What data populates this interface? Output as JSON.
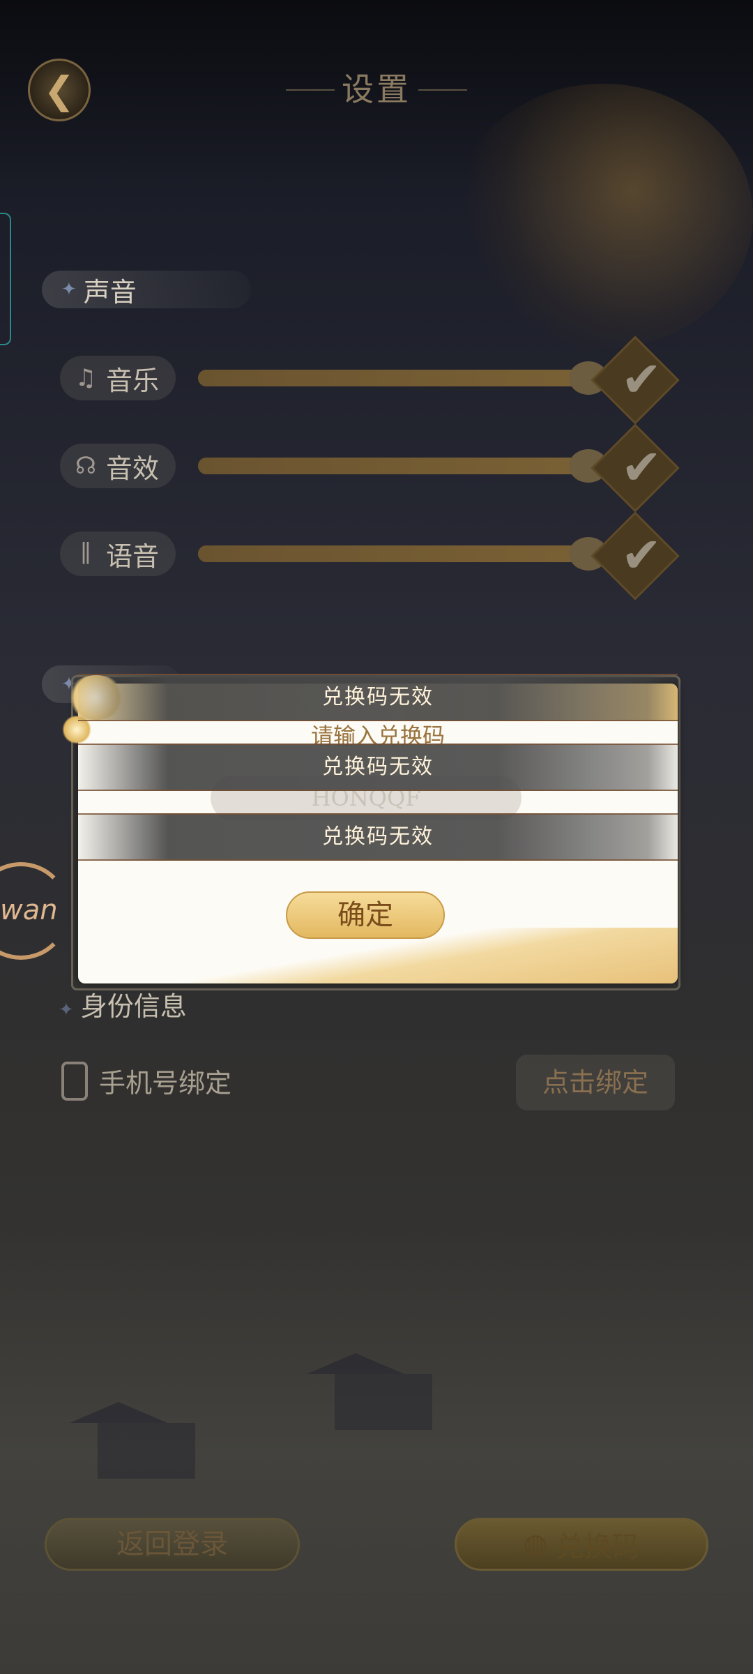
{
  "header": {
    "title": "设置",
    "back_icon": "back-arrow-icon"
  },
  "sound_section": {
    "title": "声音",
    "rows": [
      {
        "label": "音乐",
        "icon": "music-note-icon",
        "glyph": "♫",
        "level": 1.0,
        "enabled": true
      },
      {
        "label": "音效",
        "icon": "headphones-icon",
        "glyph": "☊",
        "level": 1.0,
        "enabled": true
      },
      {
        "label": "语音",
        "icon": "voice-wave-icon",
        "glyph": "∥",
        "level": 1.0,
        "enabled": true
      }
    ]
  },
  "identity_section": {
    "title": "身份信息",
    "phone_label": "手机号绑定",
    "bind_button": "点击绑定"
  },
  "footer": {
    "back_login": "返回登录",
    "redeem": "兑换码",
    "redeem_icon": "money-bag-icon"
  },
  "modal": {
    "title": "请输入兑换码",
    "input_value": "HONQQF",
    "confirm": "确定"
  },
  "toasts": [
    "兑换码无效",
    "兑换码无效",
    "兑换码无效"
  ],
  "logo_text": "wan",
  "colors": {
    "accent_gold": "#e3b860",
    "slider": "#5c4a2a",
    "toast_text": "#fff3dc"
  }
}
